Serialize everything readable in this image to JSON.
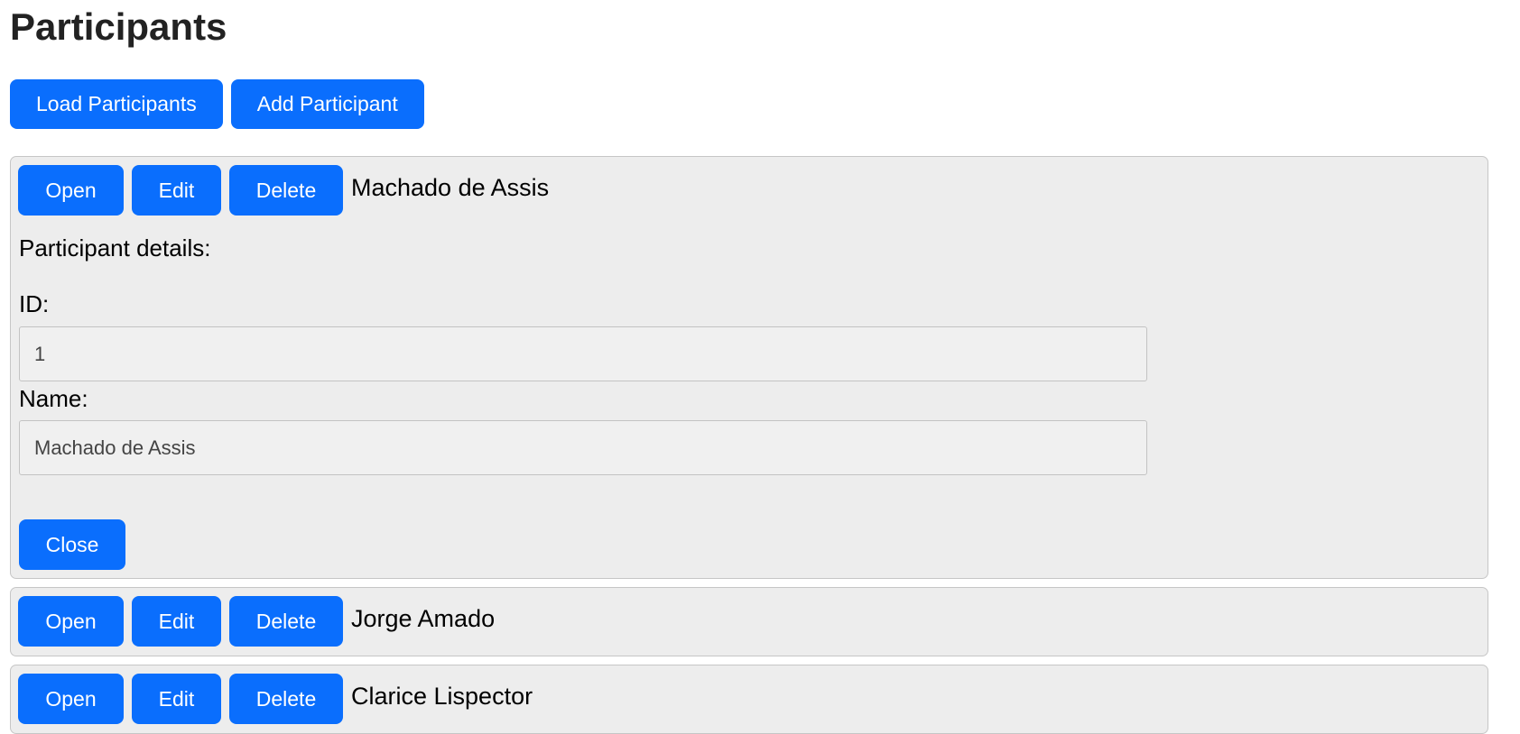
{
  "page": {
    "title": "Participants"
  },
  "toolbar": {
    "load_label": "Load Participants",
    "add_label": "Add Participant"
  },
  "actions": {
    "open": "Open",
    "edit": "Edit",
    "delete": "Delete",
    "close": "Close"
  },
  "details": {
    "heading": "Participant details:",
    "id_label": "ID:",
    "name_label": "Name:",
    "id_value": "1",
    "name_value": "Machado de Assis"
  },
  "participants": [
    {
      "name": "Machado de Assis"
    },
    {
      "name": "Jorge Amado"
    },
    {
      "name": "Clarice Lispector"
    }
  ]
}
